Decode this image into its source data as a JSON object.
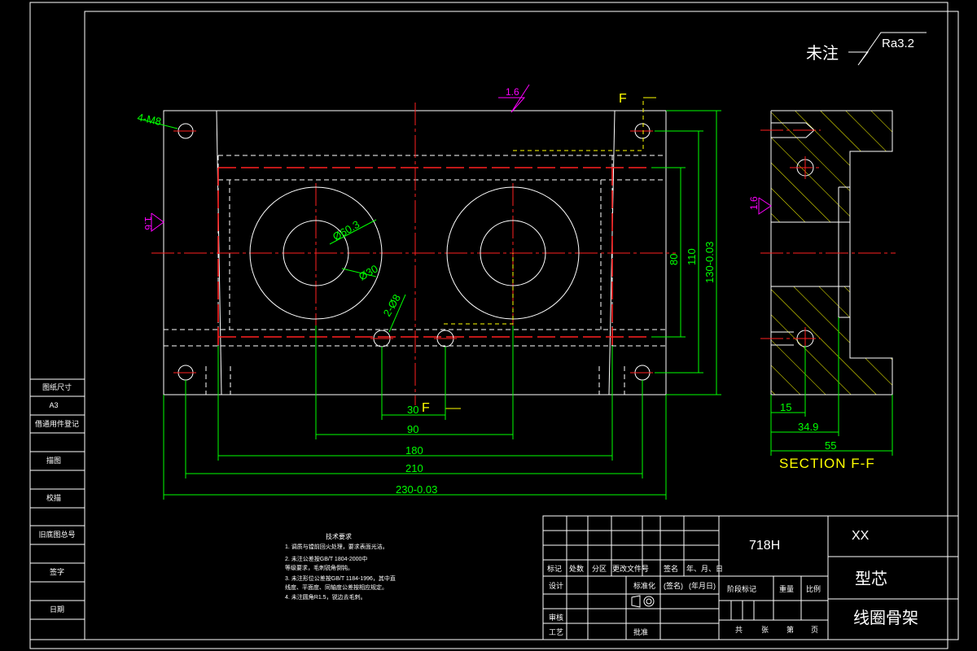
{
  "roughness": {
    "prefix": "未注",
    "value": "Ra3.2"
  },
  "surface_marks": {
    "top": "1.6",
    "left": "1.6",
    "section": "1.6"
  },
  "section_marks": {
    "top": "F",
    "bottom": "F"
  },
  "dims_main": {
    "holes": "4-M8",
    "outer_dia": "Ø60.3",
    "inner_dia": "Ø30",
    "pin": "2-Ø8",
    "v80": "80",
    "v110": "110",
    "v130": "130-0.03",
    "h30": "30",
    "h90": "90",
    "h180": "180",
    "h210": "210",
    "h230": "230-0.03"
  },
  "dims_section": {
    "d15": "15",
    "d34": "34.9",
    "d55": "55",
    "label": "SECTION F-F"
  },
  "left_column": [
    "图纸尺寸",
    "A3",
    "借通用件登记",
    "描图",
    "校描",
    "旧底图总号",
    "签字",
    "日期"
  ],
  "tech_notes": {
    "heading": "技术要求",
    "lines": [
      "1. 调质与镗前回火处理，要求表面光洁。",
      "2. 未注公差按GB/T 1804-2000中",
      "   等级要求，毛刺锐角倒钝。",
      "3. 未注形位公差按GB/T 1184-1996，其中直",
      "   线度、平面度、同轴度公差按相应规定。",
      "4. 未注圆角R1.5，锐边去毛刺。"
    ]
  },
  "title_block": {
    "material": "718H",
    "code": "XX",
    "part_type": "型芯",
    "part_name": "线圈骨架",
    "row_labels": [
      "标记",
      "处数",
      "分区",
      "更改文件号",
      "签名",
      "年、月、日"
    ],
    "design": "设计",
    "standardize": "标准化",
    "sign": "(签名)",
    "date": "(年月日)",
    "review": "审核",
    "process": "工艺",
    "approve": "批准",
    "stage_labels": [
      "阶段标记",
      "重量",
      "比例"
    ],
    "sheets": [
      "共",
      "张",
      "第",
      "页"
    ]
  }
}
